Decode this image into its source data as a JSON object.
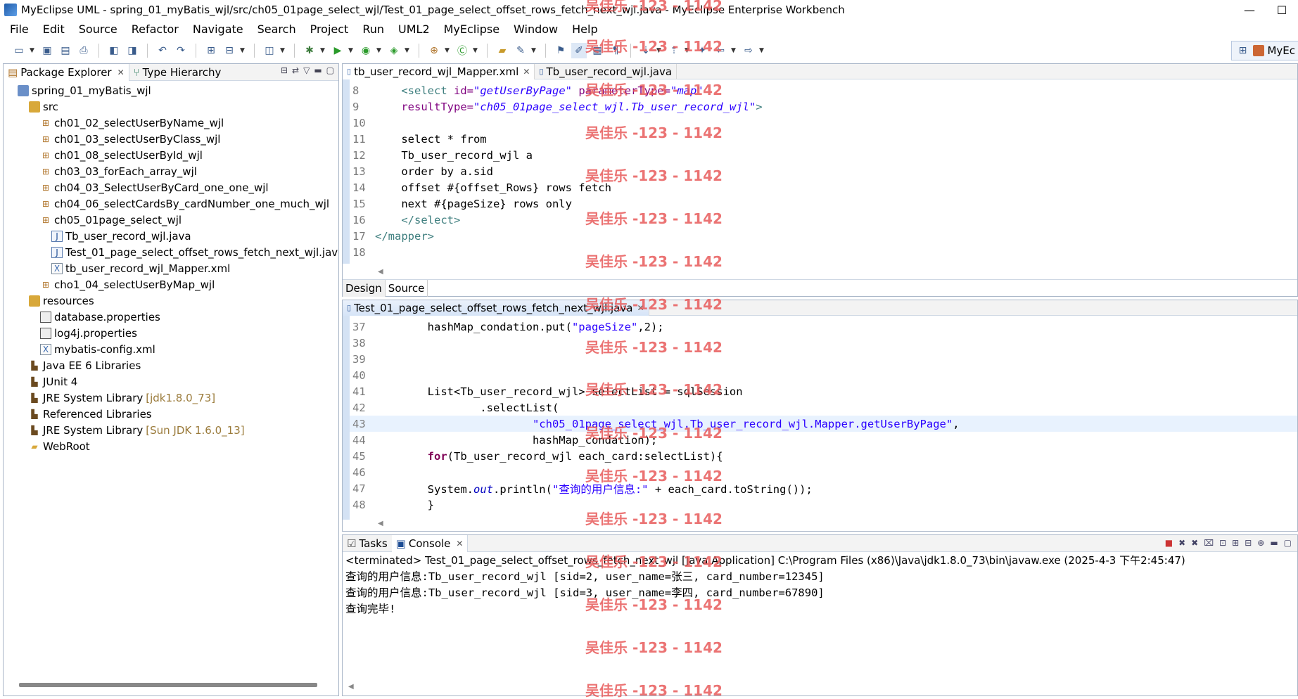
{
  "window": {
    "title": "MyEclipse UML - spring_01_myBatis_wjl/src/ch05_01page_select_wjl/Test_01_page_select_offset_rows_fetch_next_wjl.java - MyEclipse Enterprise Workbench",
    "minimize": "—",
    "maximize": "☐"
  },
  "menu": [
    "File",
    "Edit",
    "Source",
    "Refactor",
    "Navigate",
    "Search",
    "Project",
    "Run",
    "UML2",
    "MyEclipse",
    "Window",
    "Help"
  ],
  "perspective": {
    "label": "MyEc"
  },
  "package_explorer": {
    "tabs": [
      {
        "label": "Package Explorer",
        "close": "✕"
      },
      {
        "label": "Type Hierarchy"
      }
    ],
    "tree": [
      {
        "label": "spring_01_myBatis_wjl",
        "icon": "project-icon",
        "depth": 0
      },
      {
        "label": "src",
        "icon": "source-folder-icon",
        "depth": 1
      },
      {
        "label": "ch01_02_selectUserByName_wjl",
        "icon": "package-icon",
        "depth": 2
      },
      {
        "label": "ch01_03_selectUserByClass_wjl",
        "icon": "package-icon",
        "depth": 2
      },
      {
        "label": "ch01_08_selectUserById_wjl",
        "icon": "package-icon",
        "depth": 2
      },
      {
        "label": "ch03_03_forEach_array_wjl",
        "icon": "package-icon",
        "depth": 2
      },
      {
        "label": "ch04_03_SelectUserByCard_one_one_wjl",
        "icon": "package-icon",
        "depth": 2
      },
      {
        "label": "ch04_06_selectCardsBy_cardNumber_one_much_wjl",
        "icon": "package-icon",
        "depth": 2
      },
      {
        "label": "ch05_01page_select_wjl",
        "icon": "package-icon",
        "depth": 2
      },
      {
        "label": "Tb_user_record_wjl.java",
        "icon": "java-file-icon",
        "depth": 3
      },
      {
        "label": "Test_01_page_select_offset_rows_fetch_next_wjl.jav",
        "icon": "java-file-icon",
        "depth": 3
      },
      {
        "label": "tb_user_record_wjl_Mapper.xml",
        "icon": "xml-file-icon",
        "depth": 3
      },
      {
        "label": "cho1_04_selectUserByMap_wjl",
        "icon": "package-icon",
        "depth": 2
      },
      {
        "label": "resources",
        "icon": "source-folder-icon",
        "depth": 1
      },
      {
        "label": "database.properties",
        "icon": "properties-file-icon",
        "depth": 2
      },
      {
        "label": "log4j.properties",
        "icon": "properties-file-icon",
        "depth": 2
      },
      {
        "label": "mybatis-config.xml",
        "icon": "xml-file-icon",
        "depth": 2
      },
      {
        "label": "Java EE 6 Libraries",
        "icon": "library-icon",
        "depth": 1
      },
      {
        "label": "JUnit 4",
        "icon": "library-icon",
        "depth": 1
      },
      {
        "label": "JRE System Library",
        "deco": "[jdk1.8.0_73]",
        "icon": "library-icon",
        "depth": 1
      },
      {
        "label": "Referenced Libraries",
        "icon": "library-icon",
        "depth": 1
      },
      {
        "label": "JRE System Library",
        "deco": "[Sun JDK 1.6.0_13]",
        "icon": "library-icon",
        "depth": 1
      },
      {
        "label": "WebRoot",
        "icon": "folder-icon",
        "depth": 1
      }
    ]
  },
  "editor_xml": {
    "tabs": [
      {
        "label": "tb_user_record_wjl_Mapper.xml",
        "close": "✕"
      },
      {
        "label": "Tb_user_record_wjl.java"
      }
    ],
    "lines": [
      {
        "n": "8",
        "html": "    <span class=\"tag\">&lt;select</span> <span class=\"attr\">id=</span><span class=\"aval\">\"getUserByPage\"</span> <span class=\"attr\">parameterType=</span><span class=\"aval\">\"map\"</span>"
      },
      {
        "n": "9",
        "html": "    <span class=\"attr\">resultType=</span><span class=\"aval\">\"ch05_01page_select_wjl.Tb_user_record_wjl\"</span><span class=\"tag\">&gt;</span>"
      },
      {
        "n": "10",
        "html": ""
      },
      {
        "n": "11",
        "html": "    select * from"
      },
      {
        "n": "12",
        "html": "    Tb_user_record_wjl a"
      },
      {
        "n": "13",
        "html": "    order by a.sid"
      },
      {
        "n": "14",
        "html": "    offset #{offset_Rows} rows fetch"
      },
      {
        "n": "15",
        "html": "    next #{pageSize} rows only"
      },
      {
        "n": "16",
        "html": "    <span class=\"tag\">&lt;/select&gt;</span>"
      },
      {
        "n": "17",
        "html": "<span class=\"tag\">&lt;/mapper&gt;</span>"
      },
      {
        "n": "18",
        "html": ""
      }
    ],
    "modes": [
      "Design",
      "Source"
    ]
  },
  "editor_java": {
    "tabs": [
      {
        "label": "Test_01_page_select_offset_rows_fetch_next_wjl.java",
        "close": "✕"
      }
    ],
    "lines": [
      {
        "n": "37",
        "html": "        hashMap_condation.put(<span class=\"str\">\"pageSize\"</span>,2);"
      },
      {
        "n": "38",
        "html": ""
      },
      {
        "n": "39",
        "html": ""
      },
      {
        "n": "40",
        "html": ""
      },
      {
        "n": "41",
        "html": "        List&lt;Tb_user_record_wjl&gt; selectList = sqlSession"
      },
      {
        "n": "42",
        "html": "                .selectList("
      },
      {
        "n": "43",
        "html": "                        <span class=\"str\">\"ch05_01page_select_wjl.Tb_user_record_wjl.Mapper.getUserByPage\"</span>,",
        "hl": true
      },
      {
        "n": "44",
        "html": "                        hashMap_condation);"
      },
      {
        "n": "45",
        "html": "        <span class=\"kw\">for</span>(Tb_user_record_wjl each_card:selectList){"
      },
      {
        "n": "46",
        "html": ""
      },
      {
        "n": "47",
        "html": "        System.<span class=\"fld\">out</span>.println(<span class=\"str\">\"查询的用户信息:\"</span> + each_card.toString());"
      },
      {
        "n": "48",
        "html": "        }"
      }
    ]
  },
  "console": {
    "tabs": [
      {
        "label": "Tasks"
      },
      {
        "label": "Console",
        "close": "✕"
      }
    ],
    "terminated": "<terminated> Test_01_page_select_offset_rows_fetch_next_wjl [Java Application] C:\\Program Files (x86)\\Java\\jdk1.8.0_73\\bin\\javaw.exe (2025-4-3 下午2:45:47)",
    "output": [
      "查询的用户信息:Tb_user_record_wjl [sid=2, user_name=张三, card_number=12345]",
      "查询的用户信息:Tb_user_record_wjl [sid=3, user_name=李四, card_number=67890]",
      "查询完毕!"
    ]
  },
  "watermark": "吴佳乐 -123 - 1142"
}
